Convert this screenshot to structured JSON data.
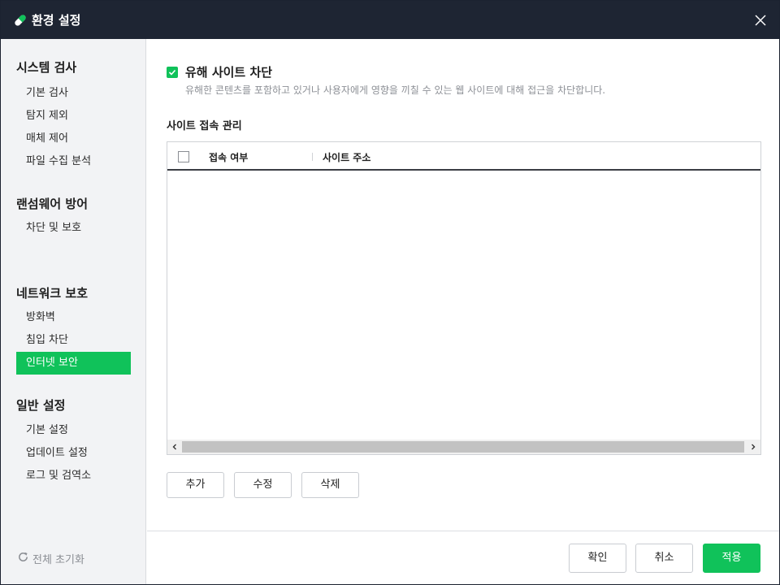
{
  "window": {
    "title": "환경 설정",
    "accent_color": "#10c25a",
    "titlebar_color": "#1e2533",
    "logo_icon": "pill-capsule-icon",
    "close_icon": "close-icon"
  },
  "sidebar": {
    "sections": [
      {
        "title": "시스템 검사",
        "items": [
          "기본 검사",
          "탐지 제외",
          "매체 제어",
          "파일 수집 분석"
        ]
      },
      {
        "title": "랜섬웨어 방어",
        "items": [
          "차단 및 보호"
        ]
      },
      {
        "title": "네트워크 보호",
        "items": [
          "방화벽",
          "침입 차단",
          "인터넷 보안"
        ]
      },
      {
        "title": "일반 설정",
        "items": [
          "기본 설정",
          "업데이트 설정",
          "로그 및 검역소"
        ]
      }
    ],
    "active_item": "인터넷 보안",
    "reset_label": "전체 초기화",
    "reset_icon": "refresh-icon"
  },
  "main": {
    "block_checkbox": {
      "checked": true,
      "label": "유해 사이트 차단"
    },
    "description": "유해한 콘텐츠를 포함하고 있거나 사용자에게 영향을 끼칠 수 있는 웹 사이트에 대해 접근을 차단합니다.",
    "section_title": "사이트 접속 관리",
    "table": {
      "columns": [
        "접속 여부",
        "사이트 주소"
      ],
      "rows": []
    },
    "buttons": {
      "add": "추가",
      "edit": "수정",
      "delete": "삭제"
    }
  },
  "footer": {
    "ok": "확인",
    "cancel": "취소",
    "apply": "적용"
  }
}
